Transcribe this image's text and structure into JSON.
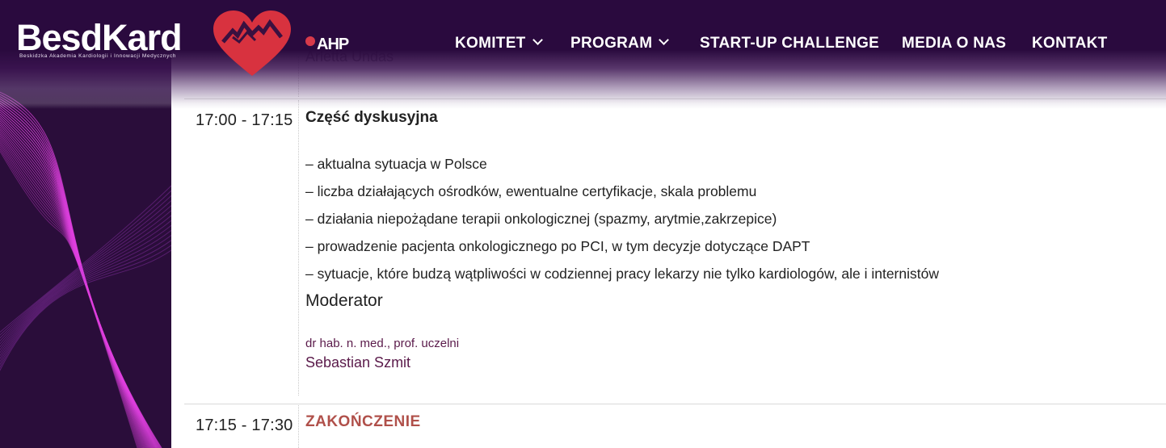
{
  "brand": {
    "logo_text": "BesdKard",
    "tagline": "Beskidzka Akademia Kardiologii i Innowacji Medycznych",
    "partner_logo": "AHP",
    "heart_color": "#d8323f"
  },
  "nav": {
    "items": [
      {
        "label": "KOMITET",
        "has_dropdown": true
      },
      {
        "label": "PROGRAM",
        "has_dropdown": true
      },
      {
        "label": "START-UP CHALLENGE",
        "has_dropdown": false
      },
      {
        "label": "MEDIA O NAS",
        "has_dropdown": false
      },
      {
        "label": "KONTAKT",
        "has_dropdown": false
      }
    ]
  },
  "program": {
    "previous_speaker": "Arletta Undas",
    "session": {
      "time": "17:00 - 17:15",
      "title": "Część dyskusyjna",
      "bullets": [
        "– aktualna sytuacja w Polsce",
        "– liczba działających ośrodków, ewentualne certyfikacje, skala problemu",
        "– działania niepożądane terapii onkologicznej (spazmy, arytmie,zakrzepice)",
        "– prowadzenie pacjenta onkologicznego po PCI, w tym decyzje dotyczące DAPT",
        "– sytuacje, które budzą wątpliwości w codziennej pracy lekarzy nie tylko kardiologów, ale i internistów"
      ],
      "moderator_heading": "Moderator",
      "moderator_title": "dr hab. n. med., prof. uczelni",
      "moderator_name": "Sebastian Szmit"
    },
    "closing": {
      "time": "17:15 - 17:30",
      "title": "ZAKOŃCZENIE"
    }
  },
  "colors": {
    "header_bg": "#2a0a3e",
    "accent_pink": "#e040e0",
    "moderator_color": "#5a1a4a",
    "closing_color": "#b0504a"
  }
}
